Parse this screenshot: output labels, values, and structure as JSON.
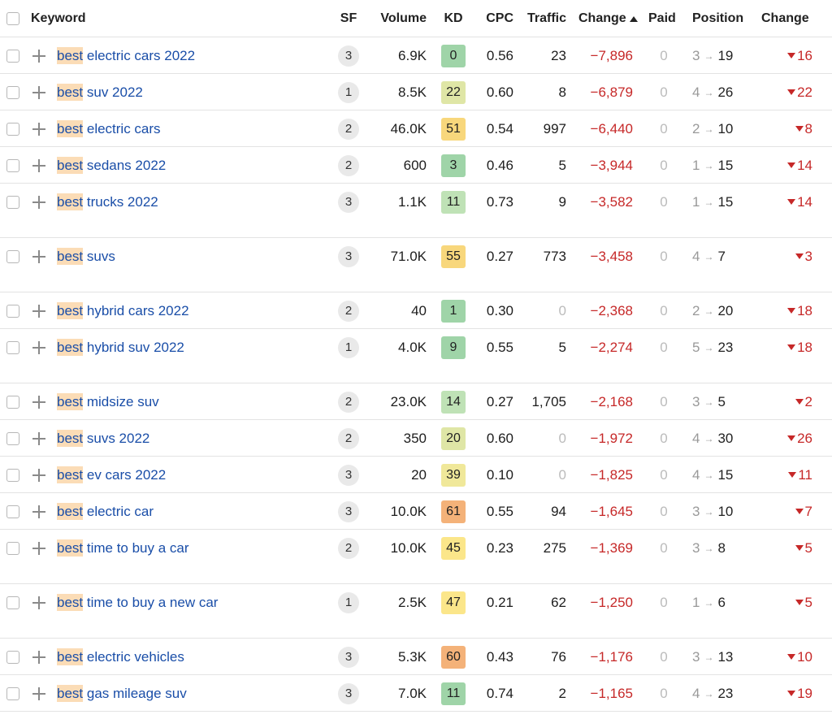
{
  "headers": {
    "keyword": "Keyword",
    "sf": "SF",
    "volume": "Volume",
    "kd": "KD",
    "cpc": "CPC",
    "traffic": "Traffic",
    "change": "Change",
    "paid": "Paid",
    "position": "Position",
    "change2": "Change"
  },
  "kd_colors": {
    "green_dark": "#9fd4a8",
    "green_light": "#cde8b7",
    "yellow_green": "#dfe6a6",
    "yellow": "#fbe68a",
    "orange_light": "#f8cc7c",
    "orange": "#f4b279"
  },
  "rows": [
    {
      "highlight": "best",
      "rest": " electric cars 2022",
      "sf": "3",
      "volume": "6.9K",
      "kd": "0",
      "kd_color": "#9fd4a8",
      "cpc": "0.56",
      "traffic": "23",
      "change": "−7,896",
      "paid": "0",
      "pos_from": "3",
      "pos_to": "19",
      "delta": "16",
      "tall": false
    },
    {
      "highlight": "best",
      "rest": " suv 2022",
      "sf": "1",
      "volume": "8.5K",
      "kd": "22",
      "kd_color": "#dfe6a6",
      "cpc": "0.60",
      "traffic": "8",
      "change": "−6,879",
      "paid": "0",
      "pos_from": "4",
      "pos_to": "26",
      "delta": "22",
      "tall": false
    },
    {
      "highlight": "best",
      "rest": " electric cars",
      "sf": "2",
      "volume": "46.0K",
      "kd": "51",
      "kd_color": "#f8d77c",
      "cpc": "0.54",
      "traffic": "997",
      "change": "−6,440",
      "paid": "0",
      "pos_from": "2",
      "pos_to": "10",
      "delta": "8",
      "tall": false
    },
    {
      "highlight": "best",
      "rest": " sedans 2022",
      "sf": "2",
      "volume": "600",
      "kd": "3",
      "kd_color": "#9fd4a8",
      "cpc": "0.46",
      "traffic": "5",
      "change": "−3,944",
      "paid": "0",
      "pos_from": "1",
      "pos_to": "15",
      "delta": "14",
      "tall": false
    },
    {
      "highlight": "best",
      "rest": " trucks 2022",
      "sf": "3",
      "volume": "1.1K",
      "kd": "11",
      "kd_color": "#bfe2b6",
      "cpc": "0.73",
      "traffic": "9",
      "change": "−3,582",
      "paid": "0",
      "pos_from": "1",
      "pos_to": "15",
      "delta": "14",
      "tall": true
    },
    {
      "highlight": "best",
      "rest": " suvs",
      "sf": "3",
      "volume": "71.0K",
      "kd": "55",
      "kd_color": "#f8d77c",
      "cpc": "0.27",
      "traffic": "773",
      "change": "−3,458",
      "paid": "0",
      "pos_from": "4",
      "pos_to": "7",
      "delta": "3",
      "tall": true
    },
    {
      "highlight": "best",
      "rest": " hybrid cars 2022",
      "sf": "2",
      "volume": "40",
      "kd": "1",
      "kd_color": "#9fd4a8",
      "cpc": "0.30",
      "traffic": "0",
      "change": "−2,368",
      "paid": "0",
      "pos_from": "2",
      "pos_to": "20",
      "delta": "18",
      "tall": false
    },
    {
      "highlight": "best",
      "rest": " hybrid suv 2022",
      "sf": "1",
      "volume": "4.0K",
      "kd": "9",
      "kd_color": "#9fd4a8",
      "cpc": "0.55",
      "traffic": "5",
      "change": "−2,274",
      "paid": "0",
      "pos_from": "5",
      "pos_to": "23",
      "delta": "18",
      "tall": true
    },
    {
      "highlight": "best",
      "rest": " midsize suv",
      "sf": "2",
      "volume": "23.0K",
      "kd": "14",
      "kd_color": "#bfe2b6",
      "cpc": "0.27",
      "traffic": "1,705",
      "change": "−2,168",
      "paid": "0",
      "pos_from": "3",
      "pos_to": "5",
      "delta": "2",
      "tall": false
    },
    {
      "highlight": "best",
      "rest": " suvs 2022",
      "sf": "2",
      "volume": "350",
      "kd": "20",
      "kd_color": "#dfe6a6",
      "cpc": "0.60",
      "traffic": "0",
      "change": "−1,972",
      "paid": "0",
      "pos_from": "4",
      "pos_to": "30",
      "delta": "26",
      "tall": false
    },
    {
      "highlight": "best",
      "rest": " ev cars 2022",
      "sf": "3",
      "volume": "20",
      "kd": "39",
      "kd_color": "#f0e89a",
      "cpc": "0.10",
      "traffic": "0",
      "change": "−1,825",
      "paid": "0",
      "pos_from": "4",
      "pos_to": "15",
      "delta": "11",
      "tall": false
    },
    {
      "highlight": "best",
      "rest": " electric car",
      "sf": "3",
      "volume": "10.0K",
      "kd": "61",
      "kd_color": "#f4b279",
      "cpc": "0.55",
      "traffic": "94",
      "change": "−1,645",
      "paid": "0",
      "pos_from": "3",
      "pos_to": "10",
      "delta": "7",
      "tall": false
    },
    {
      "highlight": "best",
      "rest": " time to buy a car",
      "sf": "2",
      "volume": "10.0K",
      "kd": "45",
      "kd_color": "#fbe68a",
      "cpc": "0.23",
      "traffic": "275",
      "change": "−1,369",
      "paid": "0",
      "pos_from": "3",
      "pos_to": "8",
      "delta": "5",
      "tall": true
    },
    {
      "highlight": "best",
      "rest": " time to buy a new car",
      "sf": "1",
      "volume": "2.5K",
      "kd": "47",
      "kd_color": "#fbe68a",
      "cpc": "0.21",
      "traffic": "62",
      "change": "−1,250",
      "paid": "0",
      "pos_from": "1",
      "pos_to": "6",
      "delta": "5",
      "tall": true
    },
    {
      "highlight": "best",
      "rest": " electric vehicles",
      "sf": "3",
      "volume": "5.3K",
      "kd": "60",
      "kd_color": "#f4b279",
      "cpc": "0.43",
      "traffic": "76",
      "change": "−1,176",
      "paid": "0",
      "pos_from": "3",
      "pos_to": "13",
      "delta": "10",
      "tall": false
    },
    {
      "highlight": "best",
      "rest": " gas mileage suv",
      "sf": "3",
      "volume": "7.0K",
      "kd": "11",
      "kd_color": "#9fd4a8",
      "cpc": "0.74",
      "traffic": "2",
      "change": "−1,165",
      "paid": "0",
      "pos_from": "4",
      "pos_to": "23",
      "delta": "19",
      "tall": false
    }
  ]
}
